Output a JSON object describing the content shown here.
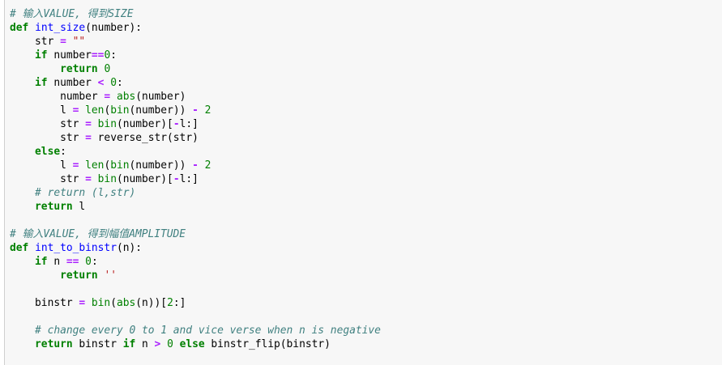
{
  "code_cell": {
    "lines": [
      [
        {
          "t": "# 输入VALUE, 得到SIZE",
          "c": "cm"
        }
      ],
      [
        {
          "t": "def",
          "c": "kw"
        },
        {
          "t": " "
        },
        {
          "t": "int_size",
          "c": "fn"
        },
        {
          "t": "(number):"
        }
      ],
      [
        {
          "t": "    str "
        },
        {
          "t": "=",
          "c": "op"
        },
        {
          "t": " "
        },
        {
          "t": "\"\"",
          "c": "str"
        }
      ],
      [
        {
          "t": "    "
        },
        {
          "t": "if",
          "c": "kw"
        },
        {
          "t": " number"
        },
        {
          "t": "==",
          "c": "op"
        },
        {
          "t": "0",
          "c": "num"
        },
        {
          "t": ":"
        }
      ],
      [
        {
          "t": "        "
        },
        {
          "t": "return",
          "c": "kw"
        },
        {
          "t": " "
        },
        {
          "t": "0",
          "c": "num"
        }
      ],
      [
        {
          "t": "    "
        },
        {
          "t": "if",
          "c": "kw"
        },
        {
          "t": " number "
        },
        {
          "t": "<",
          "c": "op"
        },
        {
          "t": " "
        },
        {
          "t": "0",
          "c": "num"
        },
        {
          "t": ":"
        }
      ],
      [
        {
          "t": "        number "
        },
        {
          "t": "=",
          "c": "op"
        },
        {
          "t": " "
        },
        {
          "t": "abs",
          "c": "bi"
        },
        {
          "t": "(number)"
        }
      ],
      [
        {
          "t": "        l "
        },
        {
          "t": "=",
          "c": "op"
        },
        {
          "t": " "
        },
        {
          "t": "len",
          "c": "bi"
        },
        {
          "t": "("
        },
        {
          "t": "bin",
          "c": "bi"
        },
        {
          "t": "(number)) "
        },
        {
          "t": "-",
          "c": "op"
        },
        {
          "t": " "
        },
        {
          "t": "2",
          "c": "num"
        }
      ],
      [
        {
          "t": "        str "
        },
        {
          "t": "=",
          "c": "op"
        },
        {
          "t": " "
        },
        {
          "t": "bin",
          "c": "bi"
        },
        {
          "t": "(number)["
        },
        {
          "t": "-",
          "c": "op"
        },
        {
          "t": "l:]"
        }
      ],
      [
        {
          "t": "        str "
        },
        {
          "t": "=",
          "c": "op"
        },
        {
          "t": " reverse_str(str)"
        }
      ],
      [
        {
          "t": "    "
        },
        {
          "t": "else",
          "c": "kw"
        },
        {
          "t": ":"
        }
      ],
      [
        {
          "t": "        l "
        },
        {
          "t": "=",
          "c": "op"
        },
        {
          "t": " "
        },
        {
          "t": "len",
          "c": "bi"
        },
        {
          "t": "("
        },
        {
          "t": "bin",
          "c": "bi"
        },
        {
          "t": "(number)) "
        },
        {
          "t": "-",
          "c": "op"
        },
        {
          "t": " "
        },
        {
          "t": "2",
          "c": "num"
        }
      ],
      [
        {
          "t": "        str "
        },
        {
          "t": "=",
          "c": "op"
        },
        {
          "t": " "
        },
        {
          "t": "bin",
          "c": "bi"
        },
        {
          "t": "(number)["
        },
        {
          "t": "-",
          "c": "op"
        },
        {
          "t": "l:]"
        }
      ],
      [
        {
          "t": "    "
        },
        {
          "t": "# return (l,str)",
          "c": "cm"
        }
      ],
      [
        {
          "t": "    "
        },
        {
          "t": "return",
          "c": "kw"
        },
        {
          "t": " l"
        }
      ],
      [],
      [
        {
          "t": "# 输入VALUE, 得到幅值AMPLITUDE",
          "c": "cm"
        }
      ],
      [
        {
          "t": "def",
          "c": "kw"
        },
        {
          "t": " "
        },
        {
          "t": "int_to_binstr",
          "c": "fn"
        },
        {
          "t": "(n):"
        }
      ],
      [
        {
          "t": "    "
        },
        {
          "t": "if",
          "c": "kw"
        },
        {
          "t": " n "
        },
        {
          "t": "==",
          "c": "op"
        },
        {
          "t": " "
        },
        {
          "t": "0",
          "c": "num"
        },
        {
          "t": ":"
        }
      ],
      [
        {
          "t": "        "
        },
        {
          "t": "return",
          "c": "kw"
        },
        {
          "t": " "
        },
        {
          "t": "''",
          "c": "str"
        }
      ],
      [],
      [
        {
          "t": "    binstr "
        },
        {
          "t": "=",
          "c": "op"
        },
        {
          "t": " "
        },
        {
          "t": "bin",
          "c": "bi"
        },
        {
          "t": "("
        },
        {
          "t": "abs",
          "c": "bi"
        },
        {
          "t": "(n))["
        },
        {
          "t": "2",
          "c": "num"
        },
        {
          "t": ":]"
        }
      ],
      [],
      [
        {
          "t": "    "
        },
        {
          "t": "# change every 0 to 1 and vice verse when n is negative",
          "c": "cm"
        }
      ],
      [
        {
          "t": "    "
        },
        {
          "t": "return",
          "c": "kw"
        },
        {
          "t": " binstr "
        },
        {
          "t": "if",
          "c": "kw"
        },
        {
          "t": " n "
        },
        {
          "t": ">",
          "c": "op"
        },
        {
          "t": " "
        },
        {
          "t": "0",
          "c": "num"
        },
        {
          "t": " "
        },
        {
          "t": "else",
          "c": "kw"
        },
        {
          "t": " binstr_flip(binstr)"
        }
      ]
    ]
  }
}
